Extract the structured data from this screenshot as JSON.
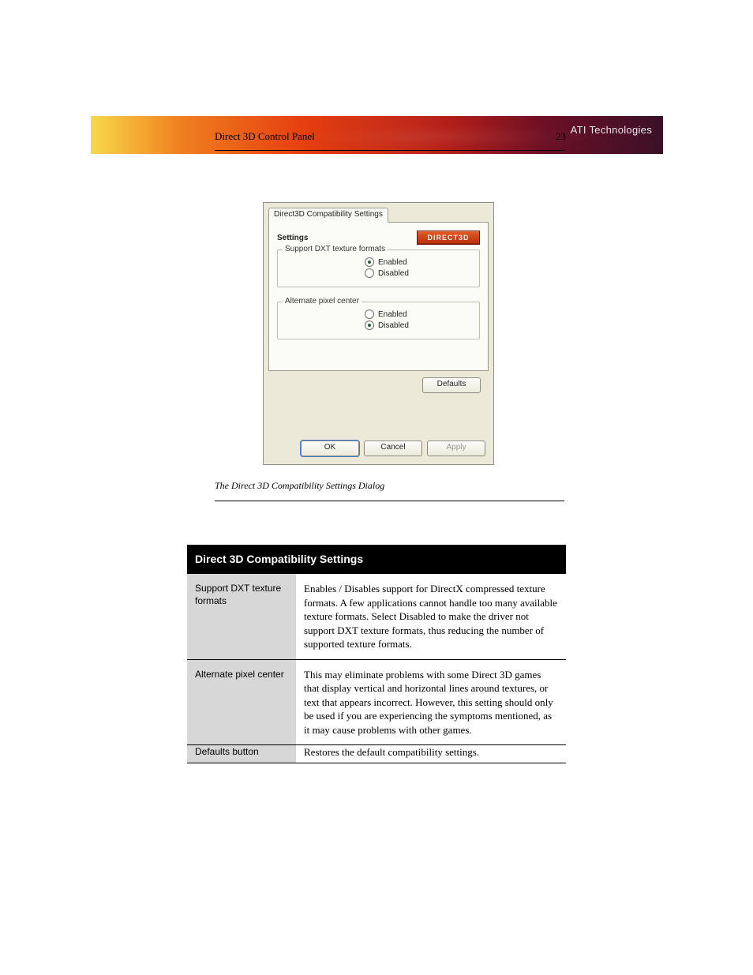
{
  "banner": {
    "brand": "ATI Technologies"
  },
  "header": {
    "section": "Direct 3D Control Panel",
    "page": "23"
  },
  "dialog": {
    "tab_label": "Direct3D Compatibility Settings",
    "settings_label": "Settings",
    "logo_text": "DIRECT3D",
    "group1": {
      "legend": "Support DXT texture formats",
      "options": {
        "enabled": "Enabled",
        "disabled": "Disabled"
      },
      "selected": "enabled"
    },
    "group2": {
      "legend": "Alternate pixel center",
      "options": {
        "enabled": "Enabled",
        "disabled": "Disabled"
      },
      "selected": "disabled"
    },
    "buttons": {
      "defaults": "Defaults",
      "ok": "OK",
      "cancel": "Cancel",
      "apply": "Apply"
    }
  },
  "caption": "The Direct 3D Compatibility Settings Dialog",
  "table": {
    "header": "Direct 3D Compatibility Settings",
    "rows": [
      {
        "label": "Support DXT texture formats",
        "desc": "Enables / Disables support for DirectX compressed texture formats. A few applications cannot handle too many available texture formats. Select Disabled to make the driver not support DXT texture formats, thus reducing the number of supported texture formats."
      },
      {
        "label": "Alternate pixel center",
        "desc": "This may eliminate problems with some Direct 3D games that display vertical and horizontal lines around textures, or text that appears incorrect. However, this setting should only be used if you are experiencing the symptoms mentioned, as it may cause problems with other games."
      },
      {
        "label": "Defaults button",
        "desc": "Restores the default compatibility settings."
      }
    ]
  }
}
